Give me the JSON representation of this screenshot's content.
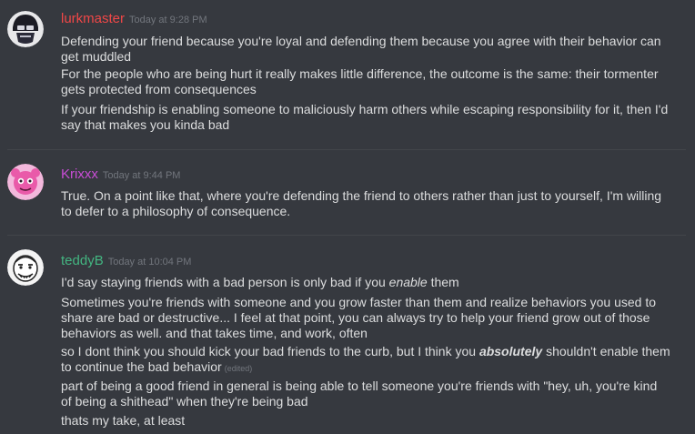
{
  "messages": [
    {
      "username": "lurkmaster",
      "username_color": "#f04747",
      "timestamp": "Today at 9:28 PM",
      "lines": [
        "Defending your friend because you're loyal and defending them because you agree with their behavior can get muddled",
        "For the people who are being hurt it really makes little difference, the outcome is the same: their tormenter gets protected from consequences",
        "If your friendship is enabling someone to maliciously harm others while escaping responsibility for it, then I'd say that makes you kinda bad"
      ]
    },
    {
      "username": "Krixxx",
      "username_color": "#c94dd6",
      "timestamp": "Today at 9:44 PM",
      "lines": [
        "True. On a point like that, where you're defending the friend to others rather than just to yourself, I'm willing to defer to a philosophy of consequence."
      ]
    },
    {
      "username": "teddyB",
      "username_color": "#43b581",
      "timestamp": "Today at 10:04 PM",
      "line1": {
        "before": "I'd say staying friends with a bad person is only bad if you ",
        "emph": "enable",
        "after": " them"
      },
      "line2": "Sometimes you're friends with someone and you grow faster than them and realize behaviors you used to share are bad or destructive... I feel at that point, you can always try to help your friend grow out of those behaviors as well. and that takes time, and work, often",
      "line3": {
        "before": "so I dont think you should kick your bad friends to the curb, but I think you ",
        "emph": "absolutely",
        "after": " shouldn't enable them to continue the bad behavior",
        "edited": "(edited)"
      },
      "line4": "part of being a good friend in general is being able to tell someone you're friends with \"hey, uh, you're kind of being a shithead\" when they're being bad",
      "line5": "thats my take, at least"
    }
  ]
}
